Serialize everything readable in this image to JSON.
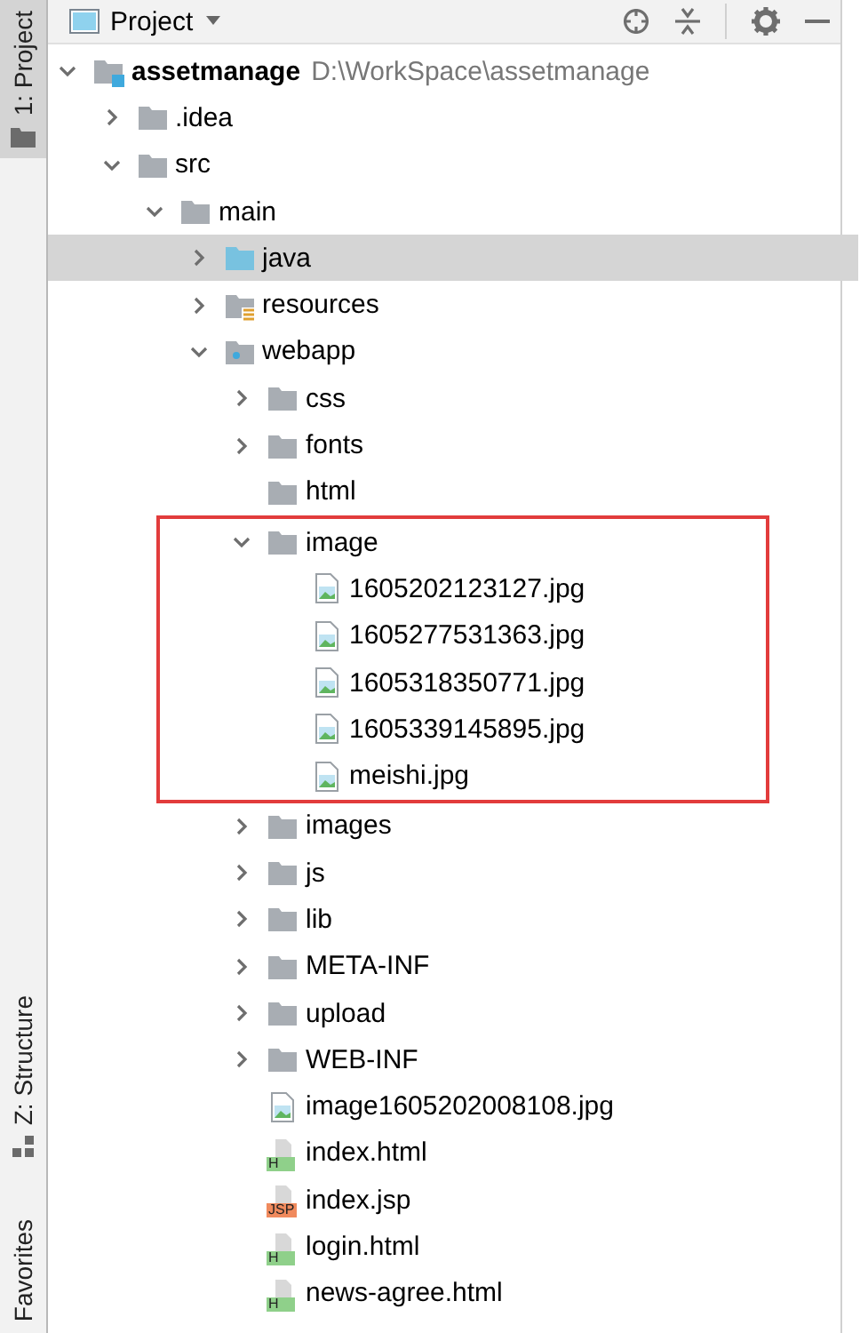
{
  "side_tabs": [
    {
      "label": "1: Project",
      "selected": true
    },
    {
      "label": "Z: Structure",
      "selected": false
    },
    {
      "label": "Favorites",
      "selected": false
    }
  ],
  "panel": {
    "title": "Project"
  },
  "tree": [
    {
      "kind": "module",
      "name": "assetmanage",
      "path": "D:\\WorkSpace\\assetmanage",
      "expanded": true,
      "selected": false,
      "children": [
        {
          "kind": "folder",
          "name": ".idea",
          "expanded": false,
          "selected": false
        },
        {
          "kind": "folder",
          "name": "src",
          "expanded": true,
          "selected": false,
          "children": [
            {
              "kind": "folder",
              "name": "main",
              "expanded": true,
              "selected": false,
              "children": [
                {
                  "kind": "source-folder",
                  "name": "java",
                  "expanded": false,
                  "selected": true
                },
                {
                  "kind": "resources-folder",
                  "name": "resources",
                  "expanded": false,
                  "selected": false
                },
                {
                  "kind": "web-folder",
                  "name": "webapp",
                  "expanded": true,
                  "selected": false,
                  "children": [
                    {
                      "kind": "folder",
                      "name": "css",
                      "expanded": false,
                      "selected": false
                    },
                    {
                      "kind": "folder",
                      "name": "fonts",
                      "expanded": false,
                      "selected": false
                    },
                    {
                      "kind": "folder",
                      "name": "html",
                      "selected": false
                    },
                    {
                      "kind": "folder",
                      "name": "image",
                      "expanded": true,
                      "selected": false,
                      "outlined": true,
                      "children": [
                        {
                          "kind": "image-file",
                          "name": "1605202123127.jpg",
                          "selected": false
                        },
                        {
                          "kind": "image-file",
                          "name": "1605277531363.jpg",
                          "selected": false
                        },
                        {
                          "kind": "image-file",
                          "name": "1605318350771.jpg",
                          "selected": false
                        },
                        {
                          "kind": "image-file",
                          "name": "1605339145895.jpg",
                          "selected": false
                        },
                        {
                          "kind": "image-file",
                          "name": "meishi.jpg",
                          "selected": false
                        }
                      ]
                    },
                    {
                      "kind": "folder",
                      "name": "images",
                      "expanded": false,
                      "selected": false
                    },
                    {
                      "kind": "folder",
                      "name": "js",
                      "expanded": false,
                      "selected": false
                    },
                    {
                      "kind": "folder",
                      "name": "lib",
                      "expanded": false,
                      "selected": false
                    },
                    {
                      "kind": "folder",
                      "name": "META-INF",
                      "expanded": false,
                      "selected": false
                    },
                    {
                      "kind": "folder",
                      "name": "upload",
                      "expanded": false,
                      "selected": false
                    },
                    {
                      "kind": "folder",
                      "name": "WEB-INF",
                      "expanded": false,
                      "selected": false
                    },
                    {
                      "kind": "image-file",
                      "name": "image1605202008108.jpg",
                      "selected": false
                    },
                    {
                      "kind": "html-file",
                      "name": "index.html",
                      "badge": "H",
                      "selected": false
                    },
                    {
                      "kind": "jsp-file",
                      "name": "index.jsp",
                      "badge": "JSP",
                      "selected": false
                    },
                    {
                      "kind": "html-file",
                      "name": "login.html",
                      "badge": "H",
                      "selected": false
                    },
                    {
                      "kind": "html-file",
                      "name": "news-agree.html",
                      "badge": "H",
                      "selected": false
                    }
                  ]
                }
              ]
            }
          ]
        }
      ]
    }
  ]
}
